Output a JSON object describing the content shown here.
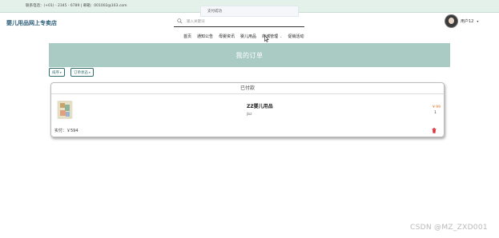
{
  "topbar": {
    "contact": "联系电话：(+01) - 2345 - 6789 | 邮箱：001002@163.com"
  },
  "toast": {
    "message": "支付成功"
  },
  "brand": {
    "name": "婴儿用品网上专卖店"
  },
  "search": {
    "placeholder": "输入关键词"
  },
  "user": {
    "name": "用户12",
    "caret": "▾"
  },
  "nav": {
    "items": [
      "首页",
      "通知公告",
      "母婴资讯",
      "婴儿用品",
      "商城管理",
      "促销活动"
    ],
    "dropdown_chevron": "⌄"
  },
  "page": {
    "title": "我的订单"
  },
  "filters": {
    "sort_label": "排序",
    "status_label": "订单状态",
    "caret": "▾"
  },
  "order": {
    "status": "已付款",
    "product_name": "ZZ婴儿用品",
    "product_desc": "jbz",
    "price": "¥ 99",
    "quantity": "1",
    "paid": "实付：￥594"
  },
  "icons": {
    "search": "search-icon",
    "avatar": "user-avatar",
    "trash": "trash-icon",
    "cursor": "mouse-cursor-icon"
  },
  "colors": {
    "brand": "#2b5d78",
    "hero_bg": "#a9cbc3",
    "accent": "#2e6b6b",
    "price": "#e4711c",
    "delete": "#d9363e",
    "topbar_bg": "#e4f1ea"
  },
  "watermark": "CSDN @MZ_ZXD001"
}
